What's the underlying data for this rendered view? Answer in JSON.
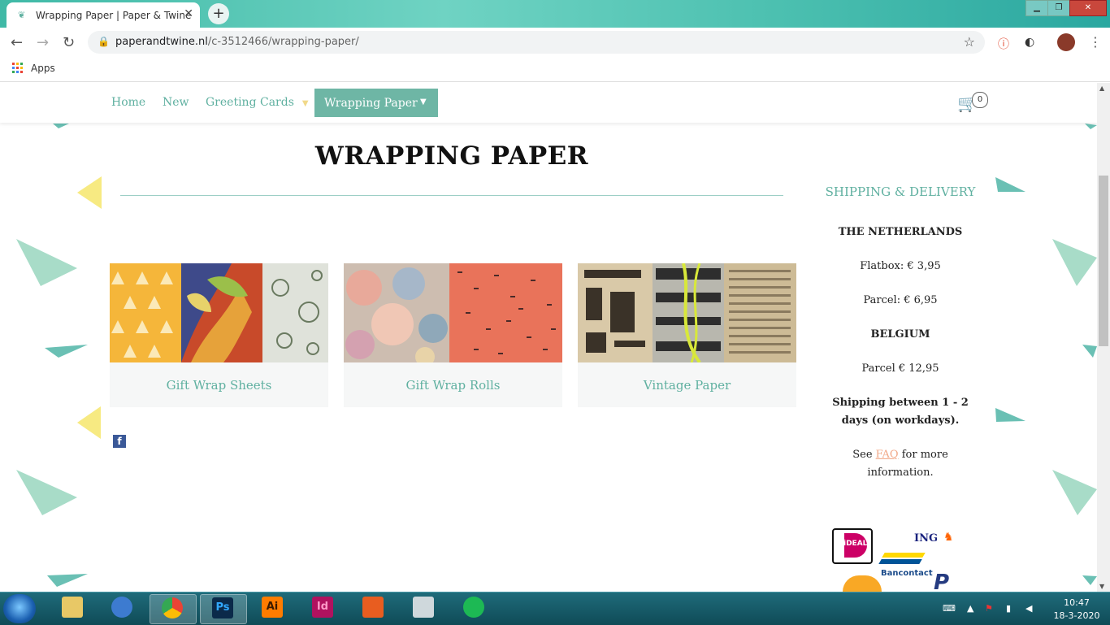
{
  "browser": {
    "tab_title": "Wrapping Paper | Paper & Twine",
    "tab_close": "✕",
    "new_tab": "+",
    "url_domain": "paperandtwine.nl",
    "url_path": "/c-3512466/wrapping-paper/",
    "back": "←",
    "forward": "→",
    "reload": "↻",
    "bookmark_star": "☆",
    "apps_label": "Apps",
    "window_minimize": "▁",
    "window_restore": "❐",
    "window_close": "✕"
  },
  "site_nav": {
    "items": [
      "Home",
      "New",
      "Greeting Cards"
    ],
    "active": "Wrapping Paper",
    "cart_count": "0"
  },
  "main": {
    "title": "WRAPPING PAPER",
    "categories": [
      {
        "label": "Gift Wrap Sheets"
      },
      {
        "label": "Gift Wrap Rolls"
      },
      {
        "label": "Vintage Paper"
      }
    ],
    "facebook": "f"
  },
  "sidebar": {
    "heading": "SHIPPING & DELIVERY",
    "nl_heading": "THE NETHERLANDS",
    "flatbox": "Flatbox: € 3,95",
    "parcel_nl": "Parcel: € 6,95",
    "be_heading": "BELGIUM",
    "parcel_be": "Parcel € 12,95",
    "shipping_line1": "Shipping between 1 - 2",
    "shipping_line2": "days (on workdays).",
    "see": "See",
    "faq": "FAQ",
    "for_more": "for more",
    "information": "information.",
    "payment": {
      "ideal": "iDEAL",
      "ing": "ING",
      "bancontact": "Bancontact",
      "paypal": "P"
    }
  },
  "taskbar": {
    "apps": [
      {
        "name": "explorer",
        "text": ""
      },
      {
        "name": "thunderbird",
        "text": ""
      },
      {
        "name": "chrome",
        "text": ""
      },
      {
        "name": "photoshop",
        "text": "Ps"
      },
      {
        "name": "illustrator",
        "text": "Ai"
      },
      {
        "name": "indesign",
        "text": "Id"
      },
      {
        "name": "app-orange",
        "text": ""
      },
      {
        "name": "calculator",
        "text": ""
      },
      {
        "name": "spotify",
        "text": ""
      }
    ],
    "time": "10:47",
    "date": "18-3-2020"
  },
  "colors": {
    "accent": "#5fb0a0",
    "nav_active": "#6eb6a5",
    "cart": "#f1a887",
    "caret": "#f1d98a",
    "tri_mint": "#a8dcc8",
    "tri_teal": "#6ac0b4",
    "tri_yellow": "#f7ea82",
    "tri_salmon": "#f4b293"
  }
}
